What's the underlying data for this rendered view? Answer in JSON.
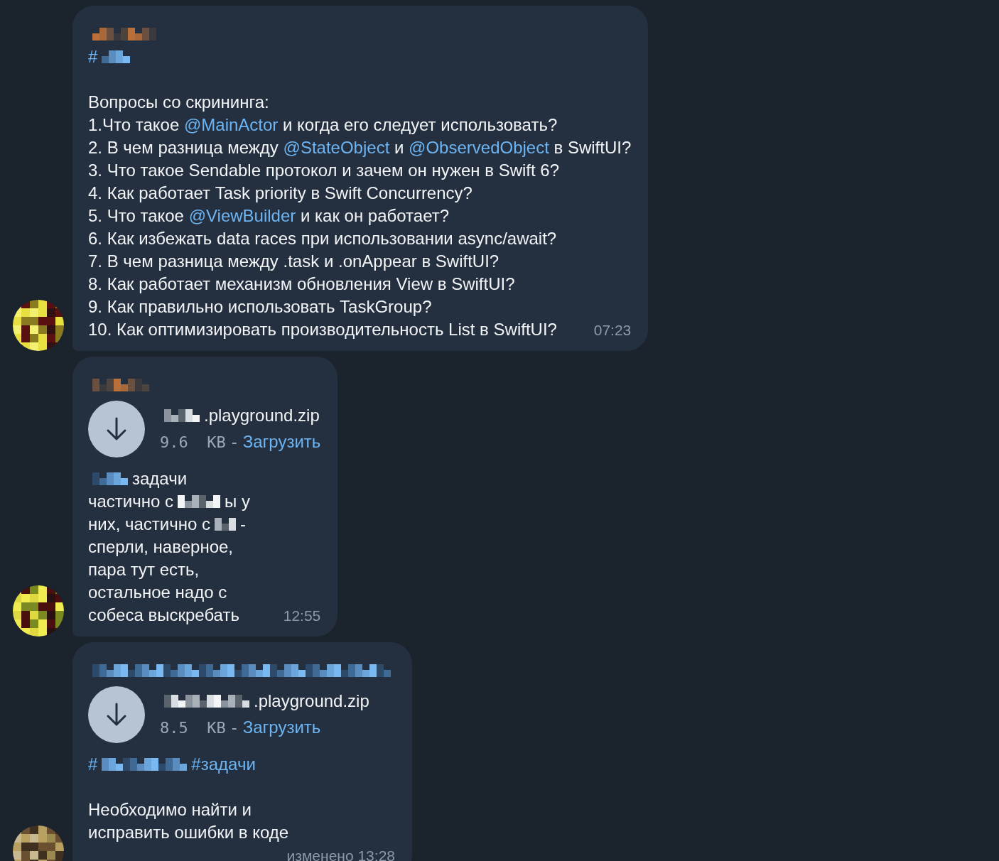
{
  "messages": [
    {
      "sender_masked": true,
      "paragraphs": [
        {
          "lines": [
            [
              {
                "kind": "link",
                "text": "#"
              },
              {
                "kind": "masked_link"
              }
            ]
          ]
        },
        {
          "lines": [
            [
              {
                "kind": "text",
                "text": "Вопросы со скрининга:"
              }
            ],
            [
              {
                "kind": "text",
                "text": "1.Что такое "
              },
              {
                "kind": "link",
                "text": "@MainActor"
              },
              {
                "kind": "text",
                "text": " и когда его следует использовать?"
              }
            ],
            [
              {
                "kind": "text",
                "text": "2. В чем разница между "
              },
              {
                "kind": "link",
                "text": "@StateObject"
              },
              {
                "kind": "text",
                "text": " и "
              },
              {
                "kind": "link",
                "text": "@ObservedObject"
              },
              {
                "kind": "text",
                "text": " в SwiftUI?"
              }
            ],
            [
              {
                "kind": "text",
                "text": "3. Что такое Sendable протокол и зачем он нужен в Swift 6?"
              }
            ],
            [
              {
                "kind": "text",
                "text": "4. Как работает Task priority в Swift Concurrency?"
              }
            ],
            [
              {
                "kind": "text",
                "text": "5. Что такое "
              },
              {
                "kind": "link",
                "text": "@ViewBuilder"
              },
              {
                "kind": "text",
                "text": " и как он работает?"
              }
            ],
            [
              {
                "kind": "text",
                "text": "6. Как избежать data races при использовании async/await?"
              }
            ],
            [
              {
                "kind": "text",
                "text": "7. В чем разница между .task и .onAppear в SwiftUI?"
              }
            ],
            [
              {
                "kind": "text",
                "text": "8. Как работает механизм обновления View в SwiftUI?"
              }
            ],
            [
              {
                "kind": "text",
                "text": "9. Как правильно использовать TaskGroup?"
              }
            ],
            [
              {
                "kind": "text",
                "text": "10. Как оптимизировать производительность List в SwiftUI?"
              }
            ]
          ]
        }
      ],
      "time": "07:23",
      "time_own_line": false
    },
    {
      "sender_masked": true,
      "file": {
        "name": [
          {
            "kind": "masked"
          },
          {
            "kind": "text",
            "text": ".playground.zip"
          }
        ],
        "size": "9.6  KB",
        "separator": "-",
        "action": "Загрузить"
      },
      "paragraphs": [
        {
          "lines": [
            [
              {
                "kind": "masked_link"
              },
              {
                "kind": "text",
                "text": "задачи"
              }
            ],
            [
              {
                "kind": "text",
                "text": "частично с"
              },
              {
                "kind": "masked"
              },
              {
                "kind": "text",
                "text": "ы у"
              }
            ],
            [
              {
                "kind": "text",
                "text": "них, частично с"
              },
              {
                "kind": "masked"
              },
              {
                "kind": "text",
                "text": "-"
              }
            ],
            [
              {
                "kind": "text",
                "text": "сперли, наверное,"
              }
            ],
            [
              {
                "kind": "text",
                "text": "пара тут есть,"
              }
            ],
            [
              {
                "kind": "text",
                "text": "остальное надо с"
              }
            ],
            [
              {
                "kind": "text",
                "text": "собеса выскребать"
              }
            ]
          ]
        }
      ],
      "time": "12:55",
      "time_own_line": false
    },
    {
      "sender_masked": true,
      "file": {
        "name": [
          {
            "kind": "masked"
          },
          {
            "kind": "text",
            "text": ".playground.zip"
          }
        ],
        "size": "8.5  KB",
        "separator": "-",
        "action": "Загрузить"
      },
      "paragraphs": [
        {
          "lines": [
            [
              {
                "kind": "link",
                "text": "#"
              },
              {
                "kind": "masked_link"
              },
              {
                "kind": "link",
                "text": "#задачи"
              }
            ]
          ]
        },
        {
          "lines": [
            [
              {
                "kind": "text",
                "text": "Необходимо найти и"
              }
            ],
            [
              {
                "kind": "text",
                "text": "исправить ошибки в коде"
              }
            ]
          ]
        }
      ],
      "time": "изменено 13:28",
      "time_own_line": true
    }
  ]
}
